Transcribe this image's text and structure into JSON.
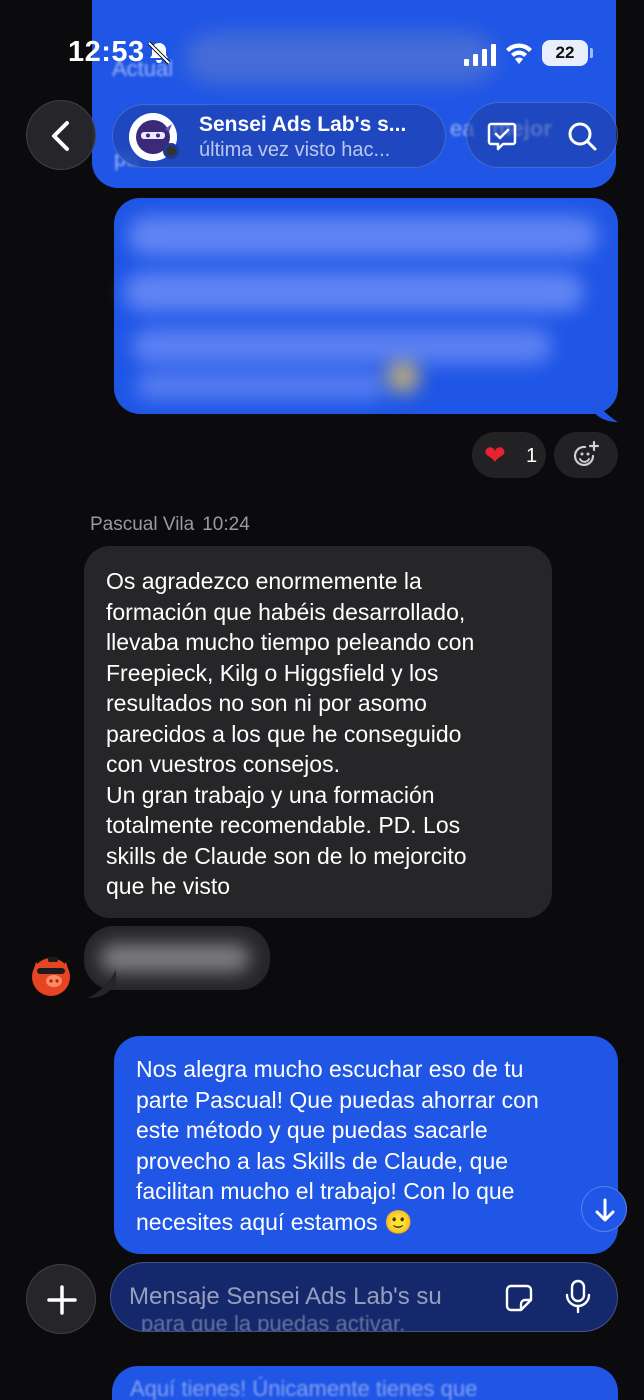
{
  "status_bar": {
    "time": "12:53",
    "battery": "22"
  },
  "top_remnant": {
    "line1": "Actual",
    "line2": "pu",
    "line3": "ea",
    "line4": "mejor"
  },
  "header": {
    "contact_name": "Sensei Ads Lab's s...",
    "contact_status": "última vez visto hac..."
  },
  "reactions": {
    "emoji": "❤",
    "count": "1"
  },
  "incoming": {
    "sender": "Pascual Vila",
    "time": "10:24",
    "lines": [
      "Os agradezco enormemente la",
      "formación que habéis desarrollado,",
      "llevaba mucho tiempo peleando con",
      "Freepieck, Kilg o Higgsfield y los",
      "resultados no son ni por asomo",
      "parecidos a los que he conseguido",
      "con vuestros consejos.",
      "Un gran trabajo y una formación",
      "totalmente recomendable. PD. Los",
      "skills de Claude son de lo mejorcito",
      "que he visto"
    ]
  },
  "outgoing": {
    "lines": [
      "Nos alegra mucho escuchar eso de tu",
      "parte Pascual! Que puedas ahorrar con",
      "este método y que puedas sacarle",
      "provecho a las Skills de Claude, que",
      "facilitan mucho el trabajo! Con lo que",
      "necesites aquí estamos 🙂"
    ]
  },
  "composer": {
    "placeholder": "Mensaje Sensei Ads Lab's su"
  },
  "bottom_remnant": {
    "line1": "para que la puedas activar.",
    "line2": "Aquí tienes! Únicamente tienes que"
  },
  "colors": {
    "accent": "#1f56e6",
    "incoming_bubble": "#262628",
    "background": "#0b0b0d",
    "heart": "#e8232f"
  }
}
